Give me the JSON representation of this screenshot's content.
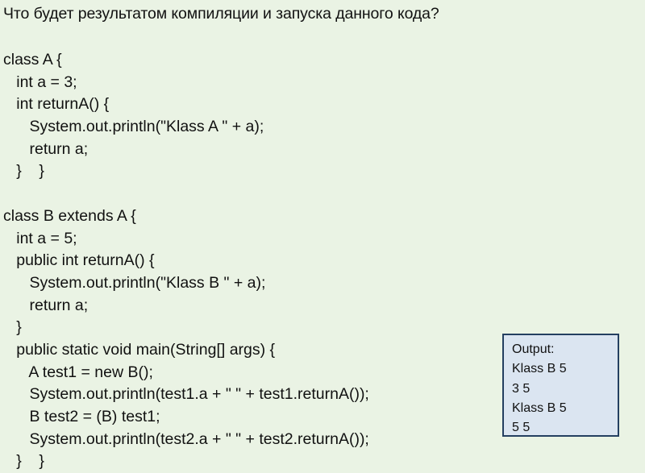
{
  "question": "Что будет результатом компиляции и запуска данного кода?",
  "code_lines": [
    "class A {",
    "   int a = 3;",
    "   int returnA() {",
    "      System.out.println(\"Klass A \" + a);",
    "      return a;",
    "   }    }",
    "",
    "class B extends A {",
    "   int a = 5;",
    "   public int returnA() {",
    "      System.out.println(\"Klass B \" + a);",
    "      return a;",
    "   }",
    "   public static void main(String[] args) {",
    "      A test1 = new B();",
    "      System.out.println(test1.a + \" \" + test1.returnA());",
    "      B test2 = (B) test1;",
    "      System.out.println(test2.a + \" \" + test2.returnA());",
    "   }    }"
  ],
  "output": {
    "title": "Output:",
    "lines": [
      "Klass B 5",
      "3 5",
      "Klass B 5",
      "5 5"
    ]
  }
}
